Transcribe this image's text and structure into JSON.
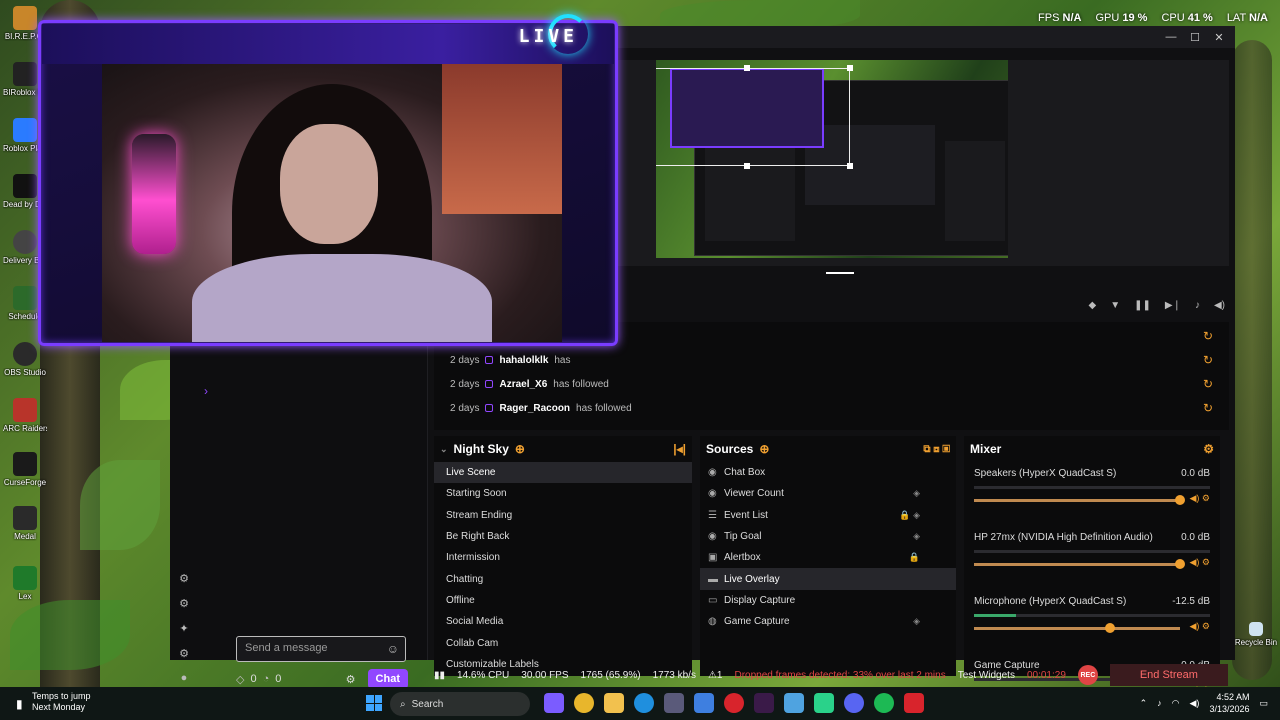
{
  "perf": {
    "fps_label": "FPS",
    "fps_value": "N/A",
    "gpu_label": "GPU",
    "gpu_value": "19 %",
    "cpu_label": "CPU",
    "cpu_value": "41 %",
    "lat_label": "LAT",
    "lat_value": "N/A"
  },
  "desktop_icons": [
    {
      "label": "BI.R.E.P.O."
    },
    {
      "label": "BIRoblox MuStudio"
    },
    {
      "label": "Roblox Player"
    },
    {
      "label": "Dead by Daylight"
    },
    {
      "label": "Delivery Beyond"
    },
    {
      "label": "Schedule"
    },
    {
      "label": "OBS Studio"
    },
    {
      "label": "ARC Raiders"
    },
    {
      "label": "CurseForge"
    },
    {
      "label": "Medal"
    },
    {
      "label": "Lex"
    }
  ],
  "recycle_bin": "Recycle Bin",
  "window": {
    "minimize": "—",
    "maximize": "☐",
    "close": "✕"
  },
  "overlay": {
    "live_text": "LIVE"
  },
  "events": [
    {
      "time": "2 days",
      "who": "hahalolklk",
      "action": "has"
    },
    {
      "time": "2 days",
      "who": "Azrael_X6",
      "action": "has followed"
    },
    {
      "time": "2 days",
      "who": "Rager_Racoon",
      "action": "has followed"
    }
  ],
  "scenes": {
    "title": "Night Sky",
    "items": [
      "Live Scene",
      "Starting Soon",
      "Stream Ending",
      "Be Right Back",
      "Intermission",
      "Chatting",
      "Offline",
      "Social Media",
      "Collab Cam",
      "Customizable Labels"
    ],
    "selected": 0
  },
  "sources": {
    "title": "Sources",
    "items": [
      {
        "label": "Chat Box",
        "icon": "eye-icon",
        "flags": ""
      },
      {
        "label": "Viewer Count",
        "icon": "eye-icon",
        "flags": "◈"
      },
      {
        "label": "Event List",
        "icon": "list-icon",
        "flags": "🔒 ◈"
      },
      {
        "label": "Tip Goal",
        "icon": "eye-icon",
        "flags": "◈"
      },
      {
        "label": "Alertbox",
        "icon": "box-icon",
        "flags": "🔒"
      },
      {
        "label": "Live Overlay",
        "icon": "folder-icon",
        "flags": ""
      },
      {
        "label": "Display Capture",
        "icon": "monitor-icon",
        "flags": ""
      },
      {
        "label": "Game Capture",
        "icon": "gamepad-icon",
        "flags": "◈"
      }
    ],
    "selected": 5
  },
  "mixer": {
    "title": "Mixer",
    "channels": [
      {
        "name": "Speakers (HyperX QuadCast S)",
        "db": "0.0 dB",
        "level": 1.0,
        "meter": 0.0
      },
      {
        "name": "HP 27mx (NVIDIA High Definition Audio)",
        "db": "0.0 dB",
        "level": 1.0,
        "meter": 0.0
      },
      {
        "name": "Microphone (HyperX QuadCast S)",
        "db": "-12.5 dB",
        "level": 0.66,
        "meter": 0.18
      },
      {
        "name": "Game Capture",
        "db": "0.0 dB",
        "level": 1.0,
        "meter": 0.0
      }
    ]
  },
  "chat": {
    "placeholder": "Send a message",
    "points": "0",
    "bits": "0",
    "button": "Chat"
  },
  "status": {
    "cpu": "14.6% CPU",
    "fps": "30.00 FPS",
    "frames": "1765 (65.9%)",
    "bitrate": "1773 kb/s",
    "warning_count": "1",
    "warning": "Dropped frames detected: 33% over last 2 mins",
    "test_widgets": "Test Widgets",
    "timer": "00:01:29",
    "rec": "REC",
    "end": "End Stream"
  },
  "taskbar": {
    "weather_line1": "Temps to jump",
    "weather_line2": "Next Monday",
    "search": "Search",
    "time": "4:52 AM",
    "date": "3/13/2026"
  },
  "colors": {
    "accent": "#f0a030",
    "twitch": "#9147ff",
    "danger": "#e04545"
  }
}
